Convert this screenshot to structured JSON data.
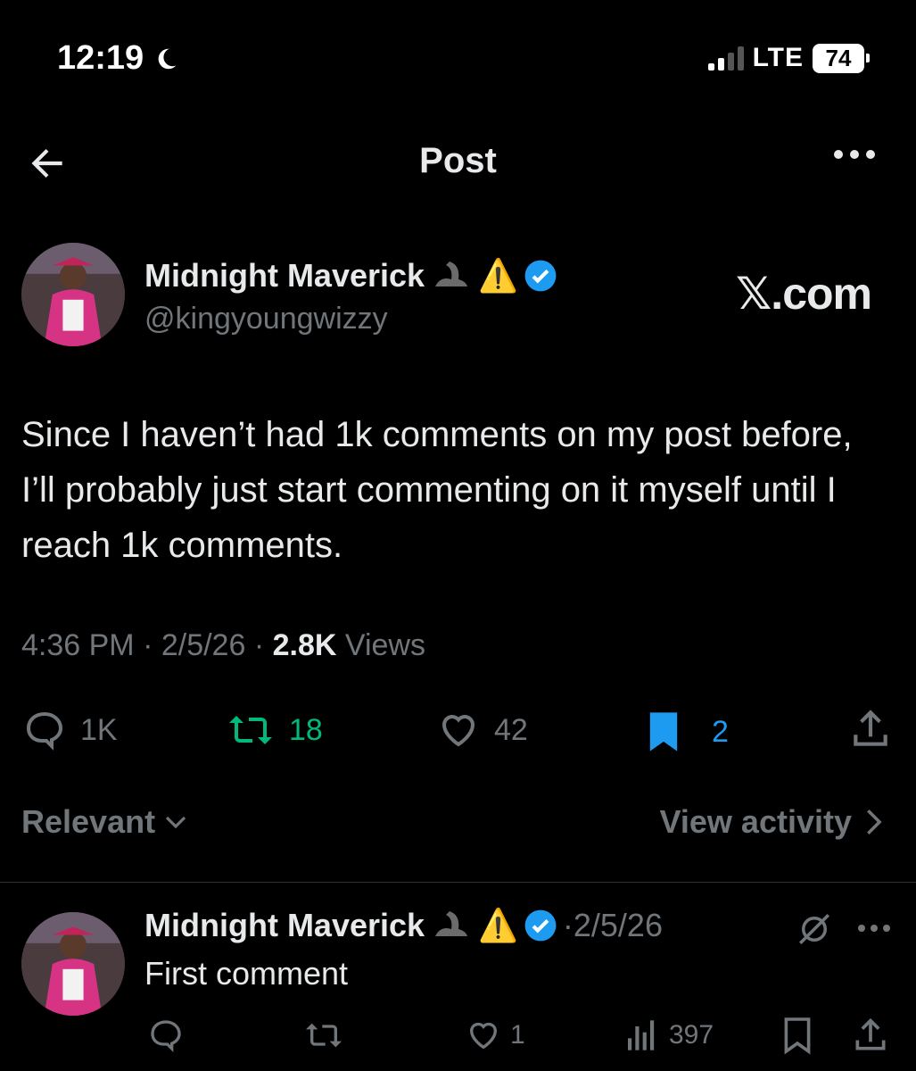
{
  "status_bar": {
    "time": "12:19",
    "network": "LTE",
    "battery": "74"
  },
  "nav": {
    "title": "Post"
  },
  "post": {
    "author_name": "Midnight Maverick",
    "author_emojis": "⚠️",
    "handle": "@kingyoungwizzy",
    "watermark": "𝕏.com",
    "text": "Since I haven’t had 1k comments on my post before, I’ll probably just start commenting on it myself until I reach 1k comments.",
    "time": "4:36 PM",
    "date": "2/5/26",
    "views_count": "2.8K",
    "views_label": "Views",
    "replies": "1K",
    "reposts": "18",
    "likes": "42",
    "bookmarks": "2"
  },
  "filter": {
    "label": "Relevant",
    "view_activity": "View activity"
  },
  "reply": {
    "author_name": "Midnight Maverick",
    "author_emojis": "⚠️",
    "date": "·2/5/26",
    "text": "First comment",
    "likes": "1",
    "views": "397"
  },
  "colors": {
    "background": "#000000",
    "text": "#e7e9ea",
    "muted": "#71767b",
    "repost_green": "#00ba7c",
    "bookmark_blue": "#1d9bf0",
    "verified_blue": "#1d9bf0"
  }
}
